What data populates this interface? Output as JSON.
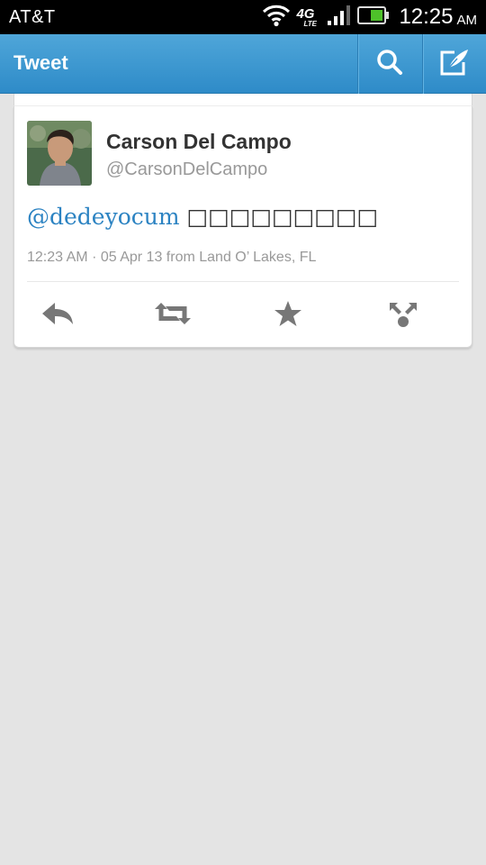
{
  "status_bar": {
    "carrier": "AT&T",
    "network": "4G",
    "network_sub": "LTE",
    "time": "12:25",
    "ampm": "AM",
    "icons": [
      "wifi-icon",
      "signal-icon",
      "battery-icon"
    ]
  },
  "action_bar": {
    "title": "Tweet",
    "icons": [
      "search-icon",
      "compose-icon"
    ],
    "color": "#3b97d3"
  },
  "tweet": {
    "user_name": "Carson Del Campo",
    "user_handle": "@CarsonDelCampo",
    "mention": "@dedeyocum",
    "body": "□□□□□□□□□",
    "timestamp": "12:23 AM",
    "date": "05 Apr 13",
    "location": "from Land O’ Lakes, FL",
    "separator": "·",
    "mention_color": "#2c83c2",
    "actions": [
      "reply-icon",
      "retweet-icon",
      "favorite-icon",
      "more-actions-icon"
    ]
  }
}
